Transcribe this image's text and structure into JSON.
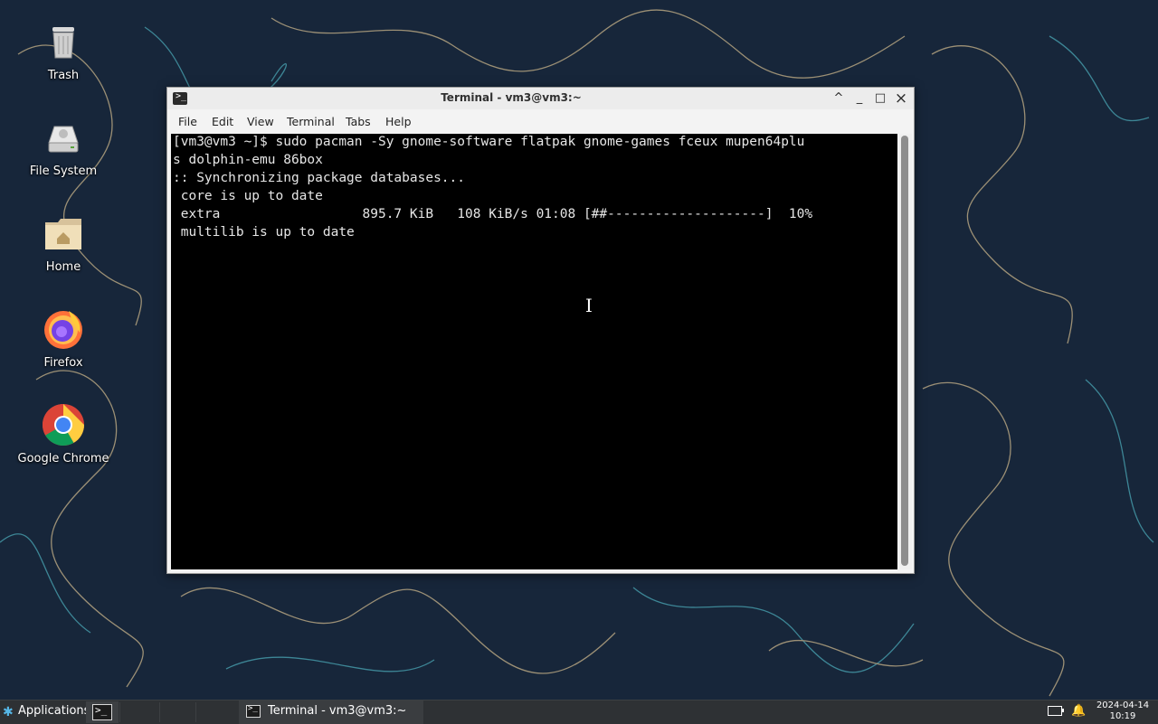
{
  "desktop": {
    "icons": [
      {
        "label": "Trash"
      },
      {
        "label": "File System"
      },
      {
        "label": "Home"
      },
      {
        "label": "Firefox"
      },
      {
        "label": "Google Chrome"
      }
    ]
  },
  "window": {
    "title": "Terminal - vm3@vm3:~",
    "controls": {
      "shade": "^",
      "minimize": "_",
      "maximize": "□",
      "close": "×"
    },
    "menu": [
      "File",
      "Edit",
      "View",
      "Terminal",
      "Tabs",
      "Help"
    ]
  },
  "terminal": {
    "lines": [
      "[vm3@vm3 ~]$ sudo pacman -Sy gnome-software flatpak gnome-games fceux mupen64plu",
      "s dolphin-emu 86box",
      ":: Synchronizing package databases...",
      " core is up to date",
      " extra                  895.7 KiB   108 KiB/s 01:08 [##--------------------]  10%",
      " multilib is up to date"
    ],
    "progress_percent": 10
  },
  "taskbar": {
    "applications_label": "Applications",
    "task_title": "Terminal - vm3@vm3:~",
    "clock_date": "2024-04-14",
    "clock_time": "10:19"
  },
  "colors": {
    "desktop_bg": "#17263a",
    "terminal_bg": "#000000",
    "terminal_fg": "#e6e6e6",
    "taskbar_bg": "#2e3134"
  }
}
